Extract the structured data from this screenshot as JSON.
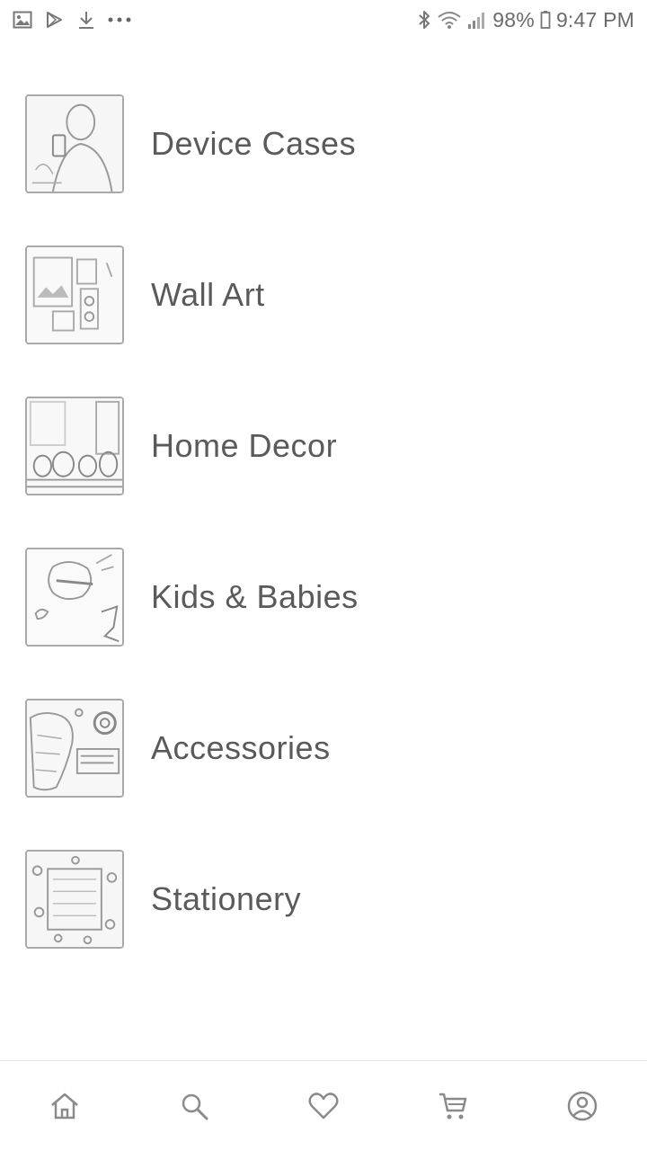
{
  "status_bar": {
    "left_icons": [
      "image-icon",
      "play-store-icon",
      "download-icon",
      "more-dots-icon"
    ],
    "right_icons": [
      "bluetooth-icon",
      "wifi-icon",
      "signal-icon"
    ],
    "battery": "98%",
    "time": "9:47 PM"
  },
  "categories": [
    {
      "label": "Device Cases",
      "icon": "device-cases-thumbnail"
    },
    {
      "label": "Wall Art",
      "icon": "wall-art-thumbnail"
    },
    {
      "label": "Home Decor",
      "icon": "home-decor-thumbnail"
    },
    {
      "label": "Kids & Babies",
      "icon": "kids-babies-thumbnail"
    },
    {
      "label": "Accessories",
      "icon": "accessories-thumbnail"
    },
    {
      "label": "Stationery",
      "icon": "stationery-thumbnail"
    }
  ],
  "bottom_nav": {
    "items": [
      "home-icon",
      "search-icon",
      "heart-icon",
      "cart-icon",
      "account-icon"
    ]
  },
  "colors": {
    "text": "#5a5a5a",
    "icon": "#8a8a8a",
    "border": "#a9a9a9",
    "background": "#ffffff"
  }
}
